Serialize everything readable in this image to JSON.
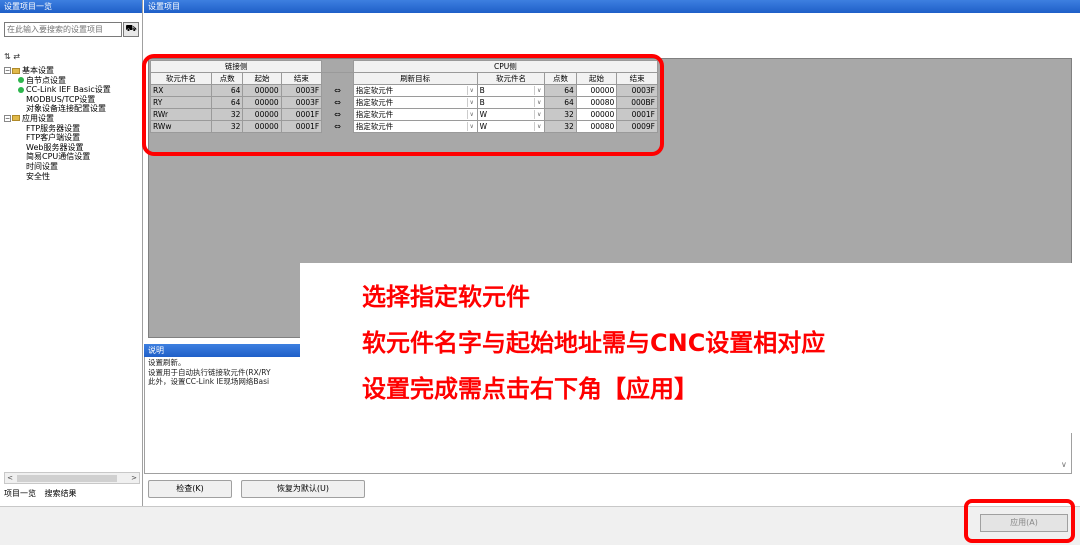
{
  "left_panel": {
    "title": "设置项目一览",
    "search_placeholder": "在此输入要搜索的设置项目",
    "search_icon": "binoculars-icon",
    "search_glyph": "⛟",
    "toolbar": "⇅ ⇄",
    "tree": [
      {
        "label": "基本设置",
        "level": 0,
        "type": "folder",
        "expander": "−"
      },
      {
        "label": "自节点设置",
        "level": 1,
        "type": "dot"
      },
      {
        "label": "CC-Link IEF Basic设置",
        "level": 1,
        "type": "dot"
      },
      {
        "label": "MODBUS/TCP设置",
        "level": 1,
        "type": "none"
      },
      {
        "label": "对象设备连接配置设置",
        "level": 1,
        "type": "none"
      },
      {
        "label": "应用设置",
        "level": 0,
        "type": "folder",
        "expander": "−"
      },
      {
        "label": "FTP服务器设置",
        "level": 1,
        "type": "none"
      },
      {
        "label": "FTP客户端设置",
        "level": 1,
        "type": "none"
      },
      {
        "label": "Web服务器设置",
        "level": 1,
        "type": "none"
      },
      {
        "label": "简易CPU通信设置",
        "level": 1,
        "type": "none"
      },
      {
        "label": "时间设置",
        "level": 1,
        "type": "none"
      },
      {
        "label": "安全性",
        "level": 1,
        "type": "none"
      }
    ],
    "scroll_left": "<",
    "scroll_right": ">",
    "tabs": [
      "项目一览",
      "搜索结果"
    ]
  },
  "right_panel": {
    "title": "设置项目",
    "grid": {
      "group_link": "链接侧",
      "group_cpu": "CPU侧",
      "headers_link": [
        "软元件名",
        "点数",
        "起始",
        "结束"
      ],
      "headers_cpu": [
        "刷新目标",
        "软元件名",
        "点数",
        "起始",
        "结束"
      ],
      "arrow_glyph": "⇔",
      "dropdown_glyph": "∨",
      "rows": [
        {
          "link_dev": "RX",
          "link_pts": "64",
          "link_start": "00000",
          "link_end": "0003F",
          "target": "指定软元件",
          "cpu_dev": "B",
          "cpu_pts": "64",
          "cpu_start": "00000",
          "cpu_end": "0003F"
        },
        {
          "link_dev": "RY",
          "link_pts": "64",
          "link_start": "00000",
          "link_end": "0003F",
          "target": "指定软元件",
          "cpu_dev": "B",
          "cpu_pts": "64",
          "cpu_start": "00080",
          "cpu_end": "000BF"
        },
        {
          "link_dev": "RWr",
          "link_pts": "32",
          "link_start": "00000",
          "link_end": "0001F",
          "target": "指定软元件",
          "cpu_dev": "W",
          "cpu_pts": "32",
          "cpu_start": "00000",
          "cpu_end": "0001F"
        },
        {
          "link_dev": "RWw",
          "link_pts": "32",
          "link_start": "00000",
          "link_end": "0001F",
          "target": "指定软元件",
          "cpu_dev": "W",
          "cpu_pts": "32",
          "cpu_start": "00080",
          "cpu_end": "0009F"
        }
      ]
    },
    "description": {
      "title": "说明",
      "lines": [
        "设置刷新。",
        "设置用于自动执行链接软元件(RX/RY",
        "此外，设置CC-Link IE现场网络Basi"
      ]
    },
    "buttons": {
      "check": "检查(K)",
      "restore_default": "恢复为默认(U)",
      "apply": "应用(A)"
    },
    "scroll_down": "∨"
  },
  "annotation": {
    "line1": "选择指定软元件",
    "line2": "软元件名字与起始地址需与CNC设置相对应",
    "line3": "设置完成需点击右下角【应用】",
    "color": "#ff0000"
  }
}
